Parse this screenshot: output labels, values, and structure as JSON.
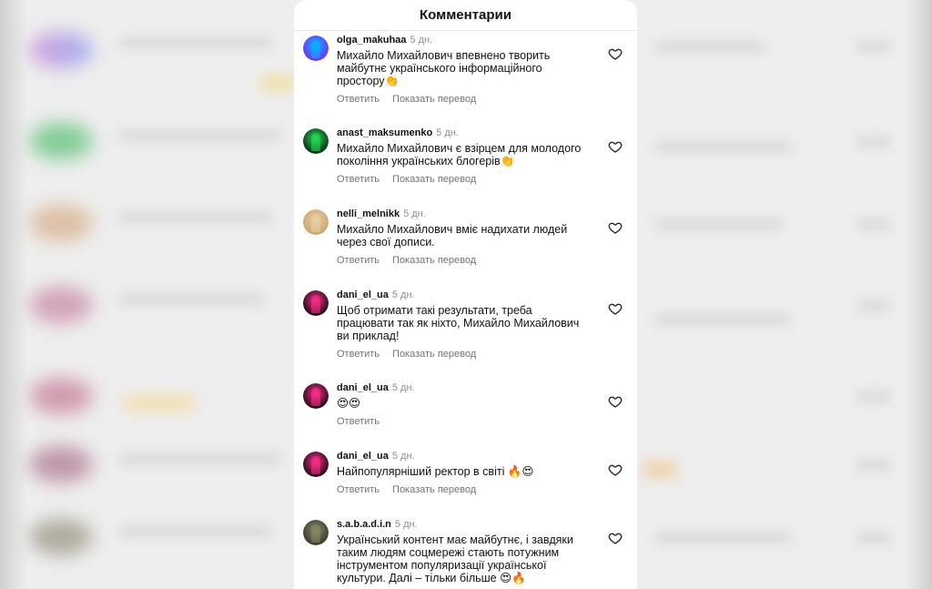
{
  "modal": {
    "title": "Комментарии",
    "reply_label": "Ответить",
    "translate_label": "Показать перевод"
  },
  "comments": [
    {
      "username": "olga_makuhaa",
      "time": "5 дн.",
      "text": "Михайло Михайлович впевнено творить майбутнє українського інформаційного простору👏",
      "avatar_colors": [
        "#7a2cff",
        "#00b7ff"
      ],
      "show_translate": true
    },
    {
      "username": "anast_maksumenko",
      "time": "5 дн.",
      "text": "Михайло Михайлович є взірцем для молодого покоління українських блогерів👏",
      "avatar_colors": [
        "#0a2a12",
        "#22dd55"
      ],
      "show_translate": true
    },
    {
      "username": "nelli_melnikk",
      "time": "5 дн.",
      "text": "Михайло Михайлович вміє надихати людей через свої дописи.",
      "avatar_colors": [
        "#caa36a",
        "#e7d1a6"
      ],
      "show_translate": true
    },
    {
      "username": "dani_el_ua",
      "time": "5 дн.",
      "text": "Щоб отримати такі результати, треба працювати так як ніхто, Михайло Михайлович ви приклад!",
      "avatar_colors": [
        "#1a0a14",
        "#ff2d8a"
      ],
      "show_translate": true
    },
    {
      "username": "dani_el_ua",
      "time": "5 дн.",
      "text": "😍😍",
      "avatar_colors": [
        "#1a0a14",
        "#ff2d8a"
      ],
      "show_translate": false
    },
    {
      "username": "dani_el_ua",
      "time": "5 дн.",
      "text": "Найпопулярніший ректор в світі 🔥😍",
      "avatar_colors": [
        "#1a0a14",
        "#ff2d8a"
      ],
      "show_translate": true
    },
    {
      "username": "s.a.b.a.d.i.n",
      "time": "5 дн.",
      "text": "Український контент має майбутнє, і завдяки таким людям соцмережі стають потужним інструментом популяризації української культури. Далі – тільки більше 😍🔥",
      "avatar_colors": [
        "#3a3a2a",
        "#8a8a6a"
      ],
      "show_translate": false
    }
  ]
}
